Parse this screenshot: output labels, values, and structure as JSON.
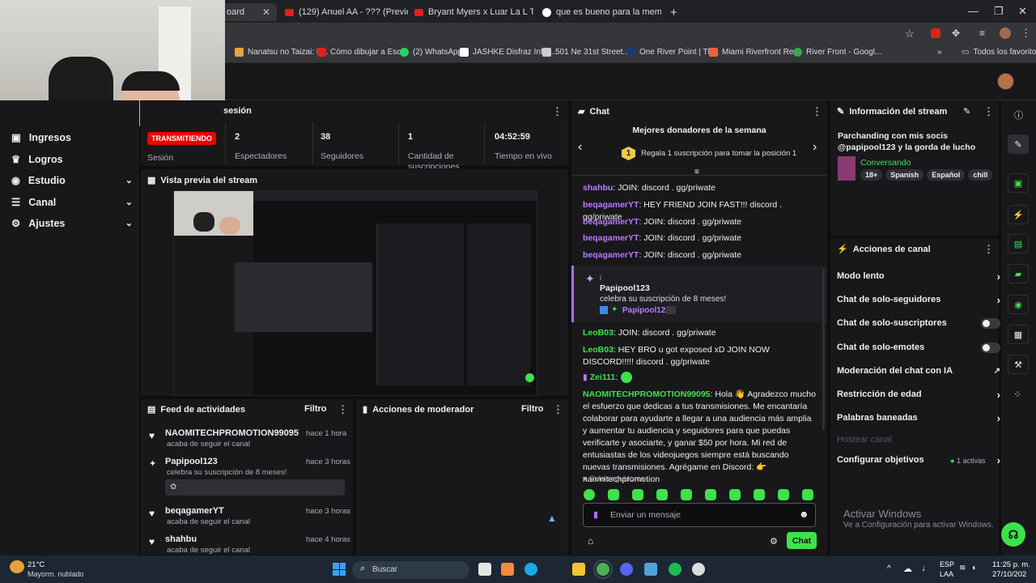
{
  "browser": {
    "tabs": [
      {
        "title": "oard",
        "active": true
      },
      {
        "title": "(129) Anuel AA - ??? (Preview N"
      },
      {
        "title": "Bryant Myers x Luar La L Type B"
      },
      {
        "title": "que es bueno para la memoria"
      }
    ],
    "bookmarks": [
      "Nanatsu no Taizai: K...",
      "Cómo dibujar a Esc...",
      "(2) WhatsApp",
      "JASHKE Disfraz Infla...",
      "501 Ne 31st Street...",
      "One River Point | Th...",
      "Miami Riverfront Re...",
      "River Front - Googl..."
    ],
    "bookmarks_all": "Todos los favoritos"
  },
  "sidebar": {
    "items": [
      {
        "label": "Ingresos",
        "icon": "dollar-icon",
        "expand": false
      },
      {
        "label": "Logros",
        "icon": "trophy-icon",
        "expand": false
      },
      {
        "label": "Estudio",
        "icon": "studio-icon",
        "expand": true
      },
      {
        "label": "Canal",
        "icon": "channel-icon",
        "expand": true
      },
      {
        "label": "Ajustes",
        "icon": "gear-icon",
        "expand": true
      }
    ]
  },
  "session": {
    "title": "sesión",
    "live_badge": "TRANSMITIENDO",
    "session_label": "Sesión",
    "stats": [
      {
        "value": "2",
        "label": "Espectadores"
      },
      {
        "value": "38",
        "label": "Seguidores"
      },
      {
        "value": "1",
        "label": "Cantidad de suscripciones"
      },
      {
        "value": "04:52:59",
        "label": "Tiempo en vivo"
      }
    ]
  },
  "preview": {
    "title": "Vista previa del stream"
  },
  "activity": {
    "title": "Feed de actividades",
    "filter": "Filtro",
    "items": [
      {
        "name": "NAOMITECHPROMOTION99095",
        "time": "hace 1 hora",
        "sub": "acaba de seguir el canal",
        "icon": "heart-icon"
      },
      {
        "name": "Papipool123",
        "time": "hace 3 horas",
        "sub": "celebra su suscripción de 8 meses!",
        "icon": "sub-icon"
      },
      {
        "name": "beqagamerYT",
        "time": "hace 3 horas",
        "sub": "acaba de seguir el canal",
        "icon": "heart-icon"
      },
      {
        "name": "shahbu",
        "time": "hace 4 horas",
        "sub": "acaba de seguir el canal",
        "icon": "heart-icon"
      }
    ]
  },
  "moderator": {
    "title": "Acciones de moderador",
    "filter": "Filtro"
  },
  "chat": {
    "title": "Chat",
    "donors_title": "Mejores donadores de la semana",
    "donors_rank": "1",
    "donors_text": "Regala 1 suscripción para tomar la posición 1",
    "messages": [
      {
        "user": "shahbu",
        "text": ": JOIN: discord . gg/priwate",
        "color": "#b87bff"
      },
      {
        "user": "beqagamerYT",
        "text": ": HEY FRIEND JOIN FAST!!! discord . gg/priwate",
        "color": "#b87bff"
      },
      {
        "user": "beqagamerYT",
        "text": ": JOIN: discord . gg/priwate",
        "color": "#b87bff"
      },
      {
        "user": "beqagamerYT",
        "text": ": JOIN: discord . gg/priwate",
        "color": "#b87bff"
      },
      {
        "user": "beqagamerYT",
        "text": ": JOIN: discord . gg/priwate",
        "color": "#b87bff"
      }
    ],
    "sub_notice": {
      "prefix": "i",
      "user": "Papipool123",
      "text": "celebra su suscripción de 8 meses!",
      "badge_user": "Papipool123:"
    },
    "messages2": [
      {
        "user": "LeoB03",
        "text": ": JOIN: discord . gg/priwate",
        "color": "#3ee24a"
      },
      {
        "user": "LeoB03",
        "text": ": HEY BRO u got exposed xD JOIN NOW DISCORD!!!!! discord . gg/priwate",
        "color": "#3ee24a"
      },
      {
        "user": "Zei111",
        "text": ":",
        "color": "#3ee24a"
      },
      {
        "user": "NAOMITECHPROMOTION99095",
        "text": ": Hola 👋 Agradezco mucho el esfuerzo que dedicas a tus transmisiones. Me encantaría colaborar para ayudarte a llegar a una audiencia más amplia y aumentar tu audiencia y seguidores para que puedas verificarte y asociarte, y ganar $50 por hora. Mi red de entusiastas de los videojuegos siempre está buscando nuevas transmisiones. Agrégame en Discord: 👉 naomitechpromotion",
        "color": "#3ee24a"
      }
    ],
    "followers_only": "Solo seguidores",
    "input_placeholder": "Enviar un mensaje",
    "send_label": "Chat"
  },
  "stream_info": {
    "title": "Información del stream",
    "stream_title": "Parchanding con mis socis @papipool123 y la gorda de lucho",
    "category": "Conversando",
    "tags": [
      "18+",
      "Spanish",
      "Español",
      "chill"
    ]
  },
  "channel_actions": {
    "title": "Acciones de canal",
    "items": [
      {
        "label": "Modo lento",
        "control": "arrow"
      },
      {
        "label": "Chat de solo-seguidores",
        "control": "arrow"
      },
      {
        "label": "Chat de solo-suscriptores",
        "control": "toggle"
      },
      {
        "label": "Chat de solo-emotes",
        "control": "toggle"
      },
      {
        "label": "Moderación del chat con IA",
        "control": "external"
      },
      {
        "label": "Restricción de edad",
        "control": "arrow"
      },
      {
        "label": "Palabras baneadas",
        "control": "arrow"
      },
      {
        "label": "Hostear canal",
        "control": "none"
      },
      {
        "label": "Configurar objetivos",
        "control": "arrow"
      }
    ],
    "objectives_badge": "1 activas"
  },
  "watermark": {
    "line1": "Activar Windows",
    "line2": "Ve a Configuración para activar Windows."
  },
  "taskbar": {
    "weather_temp": "21°C",
    "weather_desc": "Mayorm. nublado",
    "search": "Buscar",
    "lang1": "ESP",
    "lang2": "LAA",
    "time": "11:25 p. m.",
    "date": "27/10/202"
  },
  "colors": {
    "accent": "#3ee24a",
    "live": "#eb0400",
    "bg": "#0e0e10",
    "panel": "#18181b"
  }
}
